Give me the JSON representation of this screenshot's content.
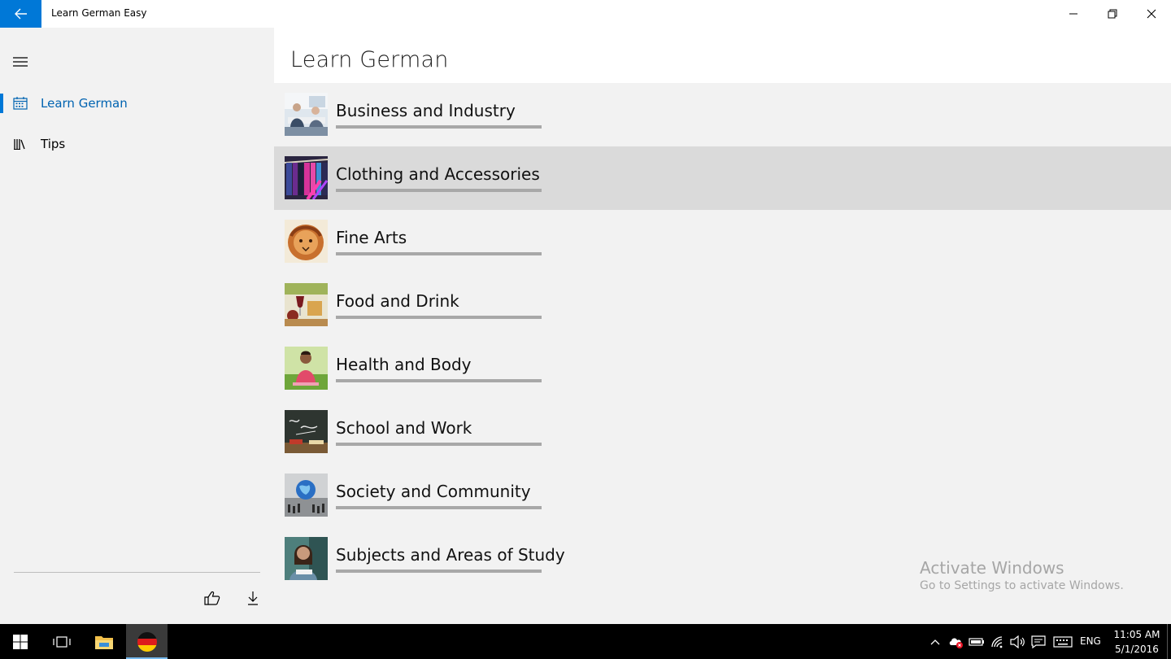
{
  "window": {
    "title": "Learn German Easy"
  },
  "sidebar": {
    "items": [
      {
        "label": "Learn German",
        "icon": "calendar-icon",
        "active": true
      },
      {
        "label": "Tips",
        "icon": "library-icon",
        "active": false
      }
    ],
    "footer_icons": [
      "like-icon",
      "download-icon"
    ]
  },
  "main": {
    "title": "Learn German",
    "categories": [
      {
        "label": "Business and Industry",
        "selected": false
      },
      {
        "label": "Clothing and Accessories",
        "selected": true
      },
      {
        "label": "Fine Arts",
        "selected": false
      },
      {
        "label": "Food and Drink",
        "selected": false
      },
      {
        "label": "Health and Body",
        "selected": false
      },
      {
        "label": "School and Work",
        "selected": false
      },
      {
        "label": "Society and Community",
        "selected": false
      },
      {
        "label": "Subjects and Areas of Study",
        "selected": false
      }
    ]
  },
  "watermark": {
    "title": "Activate Windows",
    "subtitle": "Go to Settings to activate Windows."
  },
  "taskbar": {
    "language": "ENG",
    "time": "11:05 AM",
    "date": "5/1/2016"
  },
  "colors": {
    "accent": "#0078d7",
    "selected_row": "#dadada",
    "background": "#f2f2f2"
  }
}
